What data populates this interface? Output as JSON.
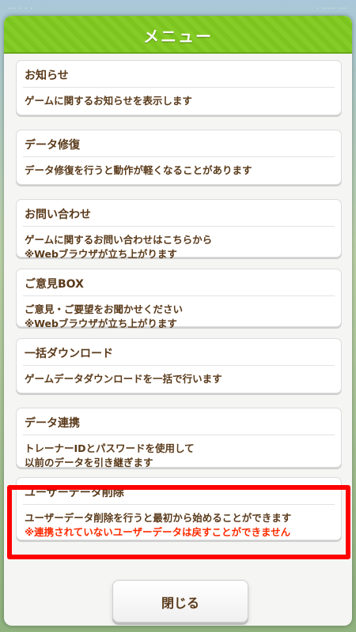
{
  "status_bar": {
    "left": "··· · · ·",
    "right": "· ····· ···"
  },
  "menu": {
    "title": "メニュー",
    "items": [
      {
        "title": "お知らせ",
        "desc1": "ゲームに関するお知らせを表示します",
        "desc2": ""
      },
      {
        "title": "データ修復",
        "desc1": "データ修復を行うと動作が軽くなることがあります",
        "desc2": ""
      },
      {
        "title": "お問い合わせ",
        "desc1": "ゲームに関するお問い合わせはこちらから",
        "desc2": "※Webブラウザが立ち上がります"
      },
      {
        "title": "ご意見BOX",
        "desc1": "ご意見・ご要望をお聞かせください",
        "desc2": "※Webブラウザが立ち上がります"
      },
      {
        "title": "一括ダウンロード",
        "desc1": "ゲームデータダウンロードを一括で行います",
        "desc2": ""
      },
      {
        "title": "データ連携",
        "desc1": "トレーナーIDとパスワードを使用して",
        "desc2": "以前のデータを引き継ぎます"
      },
      {
        "title": "ユーザーデータ削除",
        "desc1": "ユーザーデータ削除を行うと最初から始めることができます",
        "desc2": "※連携されていないユーザーデータは戻すことができません"
      }
    ],
    "close_label": "閉じる"
  },
  "colors": {
    "header": "#7cc41e",
    "text": "#5a3a1a",
    "warning": "#ff2a00",
    "highlight": "#ff0000"
  }
}
